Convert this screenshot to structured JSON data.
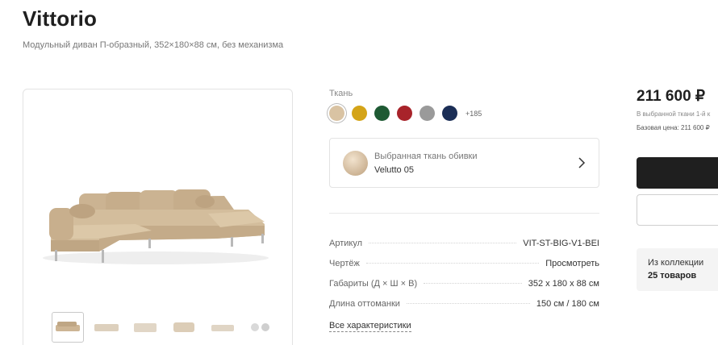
{
  "product": {
    "title": "Vittorio",
    "subtitle": "Модульный диван П-образный, 352×180×88 см, без механизма"
  },
  "gallery": {
    "main_image_icon": "sofa-image",
    "thumbnails": [
      "sofa-front-thumb",
      "sofa-ottoman-thumb",
      "sofa-side-thumb",
      "sofa-corner-thumb",
      "sofa-angle-thumb",
      "fabric-detail-thumb"
    ]
  },
  "fabric": {
    "label": "Ткань",
    "swatches": [
      {
        "name": "beige",
        "color": "#d9c3a3"
      },
      {
        "name": "yellow",
        "color": "#d4a418"
      },
      {
        "name": "green",
        "color": "#1e5a33"
      },
      {
        "name": "red",
        "color": "#a8232a"
      },
      {
        "name": "grey",
        "color": "#9a9a9a"
      },
      {
        "name": "navy",
        "color": "#1b2e56"
      }
    ],
    "more": "+185",
    "selected_caption": "Выбранная ткань обивки",
    "selected_name": "Velutto 05"
  },
  "specs": [
    {
      "key": "Артикул",
      "value": "VIT-ST-BIG-V1-BEI"
    },
    {
      "key": "Чертёж",
      "value": "Просмотреть"
    },
    {
      "key": "Габариты (Д × Ш × В)",
      "value": "352 x 180 x 88 см"
    },
    {
      "key": "Длина оттоманки",
      "value": "150 см / 180 см"
    }
  ],
  "all_characteristics": "Все характеристики",
  "pricing": {
    "price": "211 600 ₽",
    "note": "В выбранной ткани 1-й к",
    "base_price": "Базовая цена: 211 600 ₽"
  },
  "collection": {
    "line1": "Из коллекции",
    "line2": "25 товаров"
  },
  "colors": {
    "primary_button": "#1f1f1f"
  }
}
